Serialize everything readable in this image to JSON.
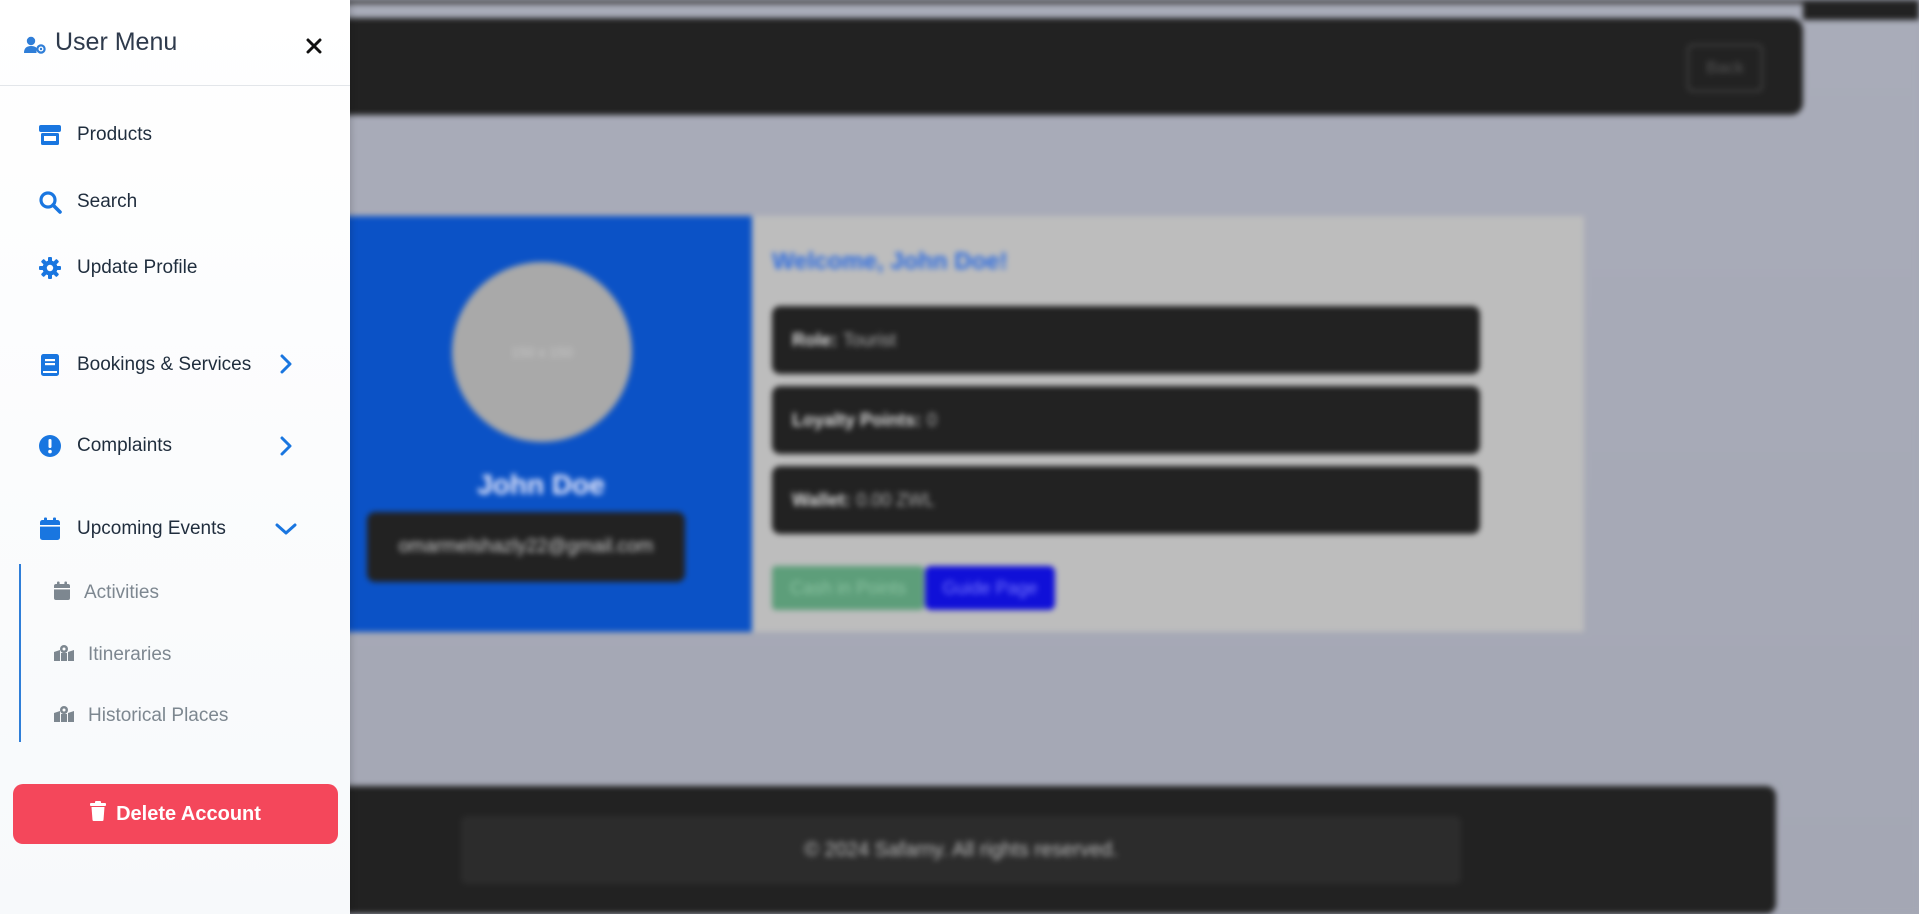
{
  "background": {
    "back_label": "Back",
    "avatar_placeholder": "150 x 150",
    "name": "John Doe",
    "email": "omarmelshazly22@gmail.com",
    "welcome": "Welcome, John Doe!",
    "info": [
      {
        "label": "Role:",
        "value": "Tourist"
      },
      {
        "label": "Loyalty Points:",
        "value": "0"
      },
      {
        "label": "Wallet:",
        "value": "0.00 ZWL"
      }
    ],
    "cash_label": "Cash in Points",
    "guide_label": "Guide Page",
    "footer": "© 2024 Safarny. All rights reserved."
  },
  "sidebar": {
    "title": "User Menu",
    "items": [
      {
        "label": "Products",
        "icon": "store-icon"
      },
      {
        "label": "Search",
        "icon": "search-icon"
      },
      {
        "label": "Update Profile",
        "icon": "gear-icon"
      },
      {
        "label": "Bookings & Services",
        "icon": "book-icon",
        "expanded": false
      },
      {
        "label": "Complaints",
        "icon": "exclamation-circle-icon",
        "expanded": false
      },
      {
        "label": "Upcoming Events",
        "icon": "calendar-icon",
        "expanded": true
      }
    ],
    "sub_items": [
      {
        "label": "Activities",
        "icon": "calendar-icon"
      },
      {
        "label": "Itineraries",
        "icon": "map-marked-icon"
      },
      {
        "label": "Historical Places",
        "icon": "map-marked-icon"
      }
    ],
    "delete_label": "Delete Account"
  },
  "colors": {
    "accent": "#1976e0",
    "danger": "#f4475b",
    "profile_blue": "#0b52c6"
  }
}
